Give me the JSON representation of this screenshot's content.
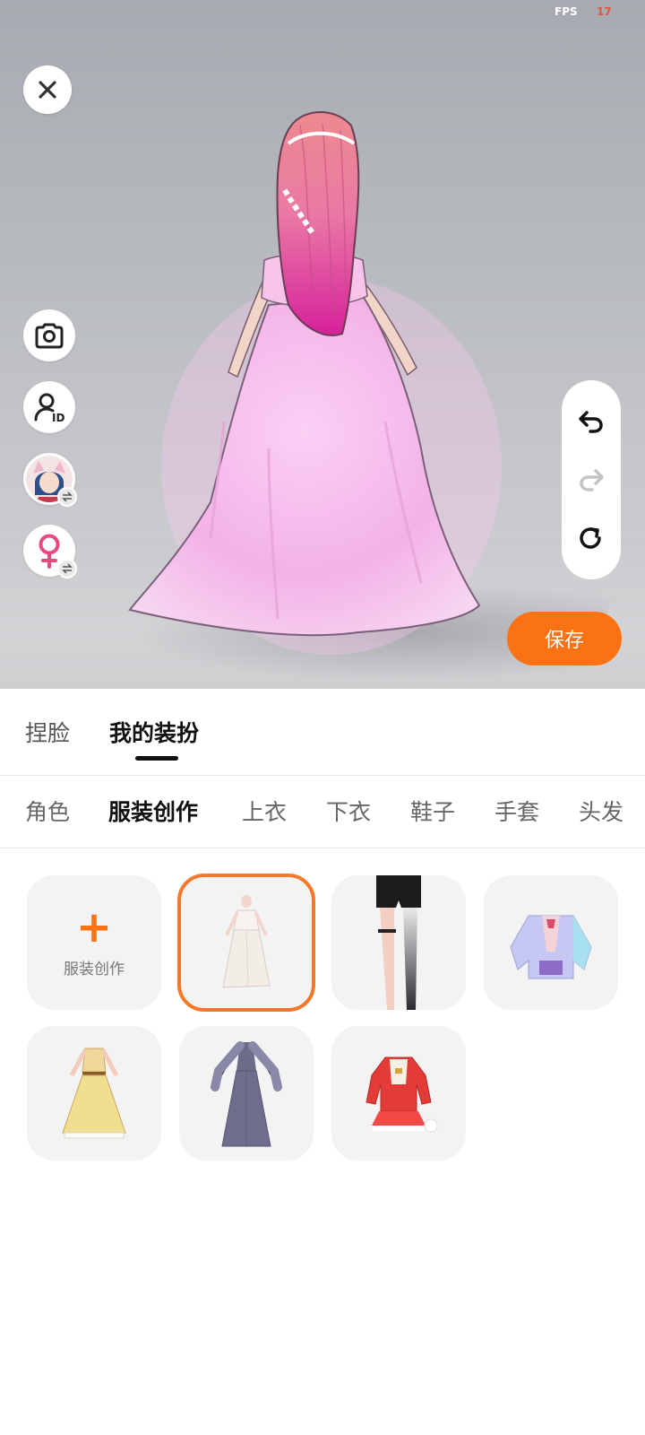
{
  "status": {
    "fps_label": "FPS",
    "fps_value": "17"
  },
  "toolbar": {
    "save_label": "保存"
  },
  "main_tabs": [
    {
      "label": "捏脸",
      "active": false
    },
    {
      "label": "我的装扮",
      "active": true
    }
  ],
  "sub_tabs": [
    {
      "label": "角色",
      "active": false
    },
    {
      "label": "服装创作",
      "active": true
    },
    {
      "label": "上衣",
      "active": false
    },
    {
      "label": "下衣",
      "active": false
    },
    {
      "label": "鞋子",
      "active": false
    },
    {
      "label": "手套",
      "active": false
    },
    {
      "label": "头发",
      "active": false
    }
  ],
  "grid": {
    "create_label": "服装创作",
    "items": [
      {
        "icon": "white-dress-icon",
        "selected": true
      },
      {
        "icon": "shorts-stocking-icon",
        "selected": false
      },
      {
        "icon": "pastel-jacket-icon",
        "selected": false
      },
      {
        "icon": "yellow-gown-icon",
        "selected": false
      },
      {
        "icon": "gray-gown-icon",
        "selected": false
      },
      {
        "icon": "red-coat-icon",
        "selected": false
      }
    ]
  },
  "colors": {
    "accent": "#fb7214",
    "selected_border": "#f5782a",
    "dress_pink": "#f4b6e8",
    "hair_pink": "#e85aa5"
  }
}
